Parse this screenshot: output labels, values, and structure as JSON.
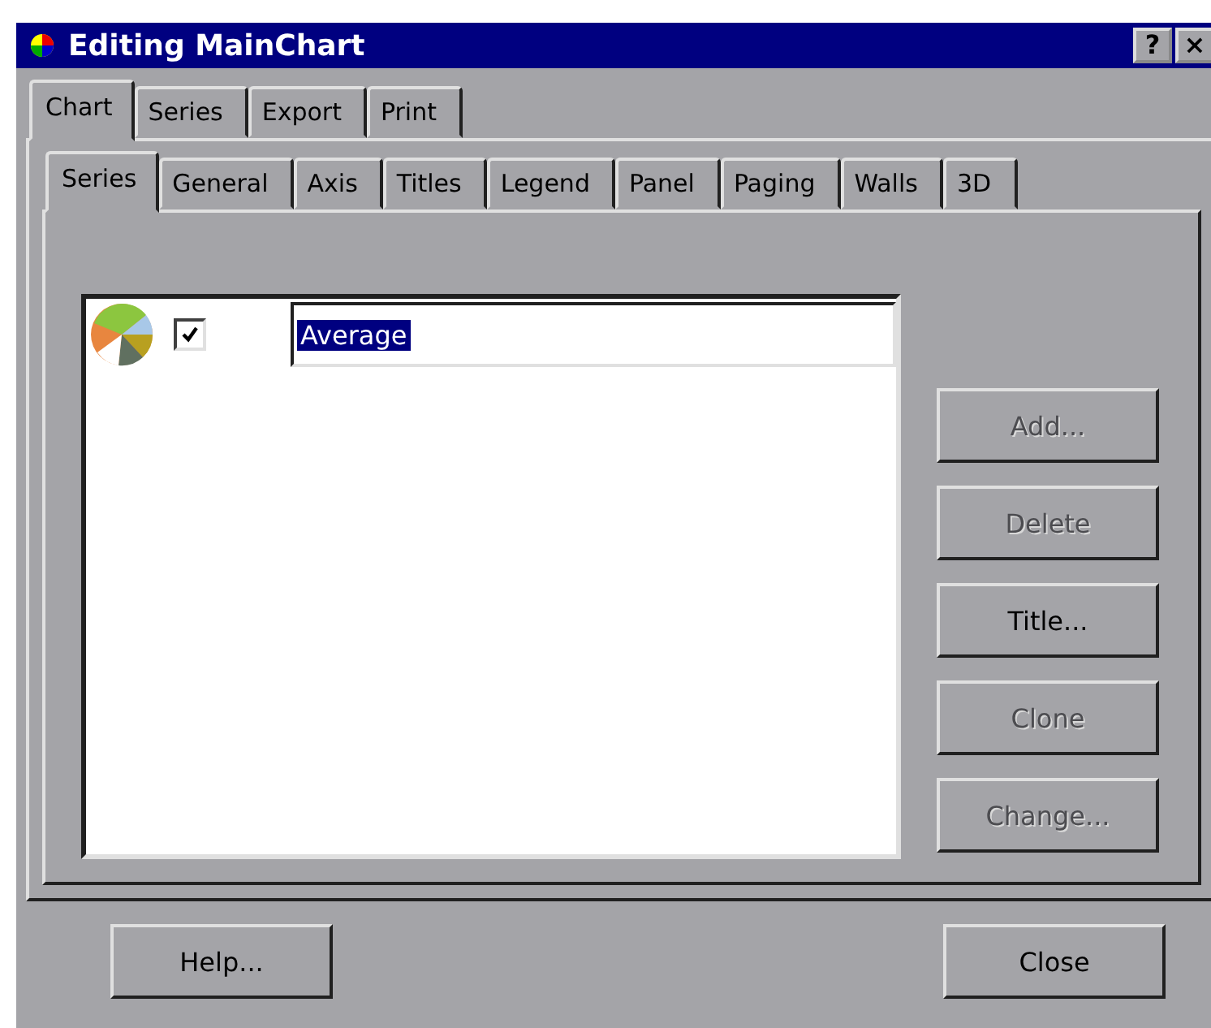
{
  "window": {
    "title": "Editing MainChart"
  },
  "title_buttons": [
    "?",
    "×"
  ],
  "tabs": [
    {
      "label": "Chart",
      "selected": true
    },
    {
      "label": "Series",
      "selected": false
    },
    {
      "label": "Export",
      "selected": false
    },
    {
      "label": "Print",
      "selected": false
    }
  ],
  "subtabs": [
    {
      "label": "Series",
      "selected": true
    },
    {
      "label": "General",
      "selected": false
    },
    {
      "label": "Axis",
      "selected": false
    },
    {
      "label": "Titles",
      "selected": false
    },
    {
      "label": "Legend",
      "selected": false
    },
    {
      "label": "Panel",
      "selected": false
    },
    {
      "label": "Paging",
      "selected": false
    },
    {
      "label": "Walls",
      "selected": false
    },
    {
      "label": "3D",
      "selected": false
    }
  ],
  "series_list": [
    {
      "title": "Average",
      "checked": true,
      "selected": true
    }
  ],
  "side_buttons": [
    {
      "label": "Add...",
      "disabled": true
    },
    {
      "label": "Delete",
      "disabled": true
    },
    {
      "label": "Title...",
      "disabled": false
    },
    {
      "label": "Clone",
      "disabled": true
    },
    {
      "label": "Change...",
      "disabled": true
    }
  ],
  "footer_buttons": [
    "Help...",
    "Close"
  ]
}
